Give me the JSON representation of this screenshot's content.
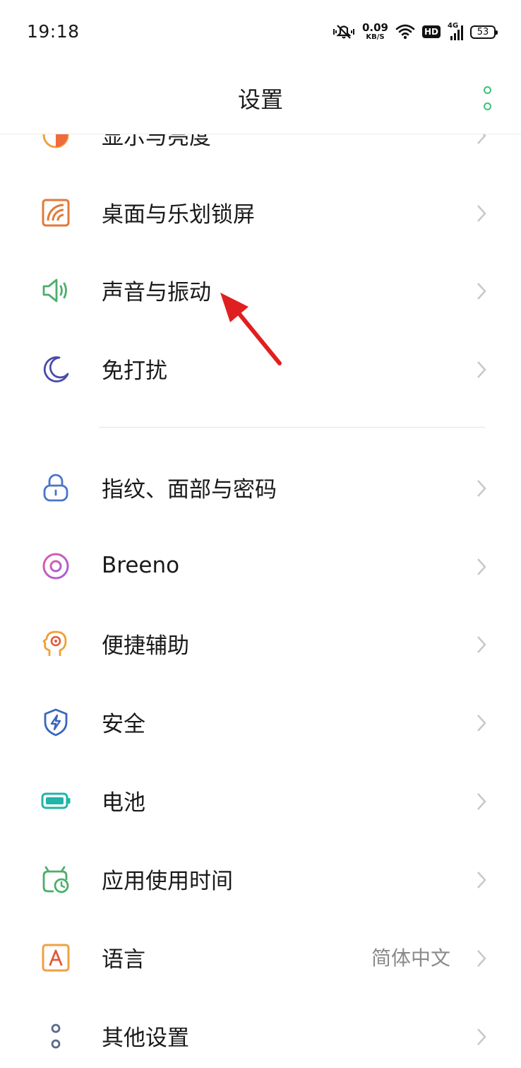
{
  "status_bar": {
    "time": "19:18",
    "net_speed_value": "0.09",
    "net_speed_unit": "KB/S",
    "hd": "HD",
    "network": "4G",
    "battery": "53"
  },
  "header": {
    "title": "设置"
  },
  "settings": {
    "display": "显示与亮度",
    "home": "桌面与乐划锁屏",
    "sound": "声音与振动",
    "dnd": "免打扰",
    "security_pw": "指纹、面部与密码",
    "breeno": "Breeno",
    "accessibility": "便捷辅助",
    "security": "安全",
    "battery": "电池",
    "screen_time": "应用使用时间",
    "language": "语言",
    "language_value": "简体中文",
    "other": "其他设置"
  },
  "colors": {
    "accent": "#3cc27a",
    "annotation_arrow": "#e02020"
  }
}
